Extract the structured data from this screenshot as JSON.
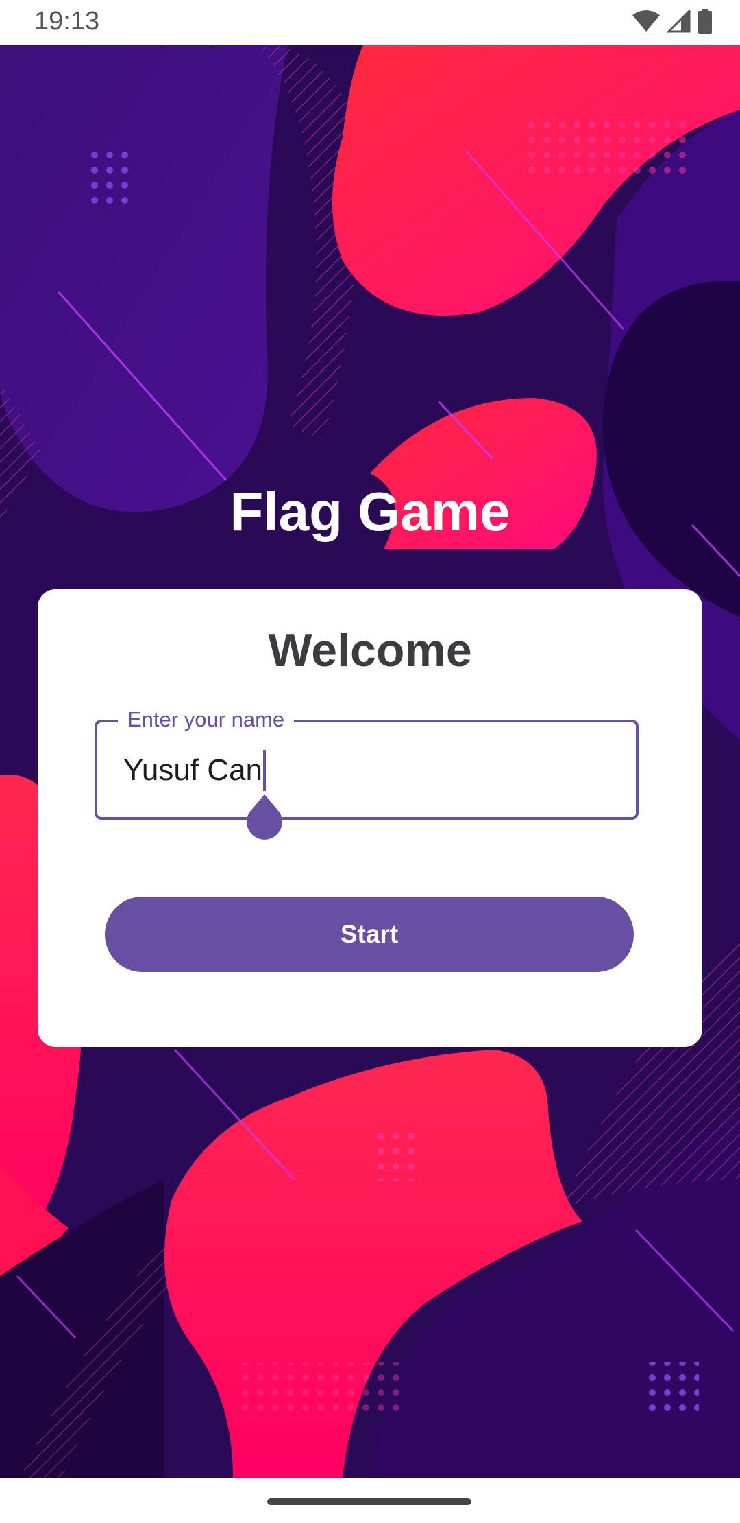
{
  "status_bar": {
    "time": "19:13",
    "icons": [
      "wifi-icon",
      "signal-icon",
      "battery-icon"
    ]
  },
  "app": {
    "title": "Flag Game"
  },
  "card": {
    "heading": "Welcome",
    "name_field": {
      "label": "Enter your name",
      "value": "Yusuf Can"
    },
    "start_label": "Start"
  },
  "colors": {
    "accent": "#6750a4",
    "background_purple": "#2b0a59",
    "blob_red": "#ff1a4a",
    "card": "#ffffff"
  }
}
